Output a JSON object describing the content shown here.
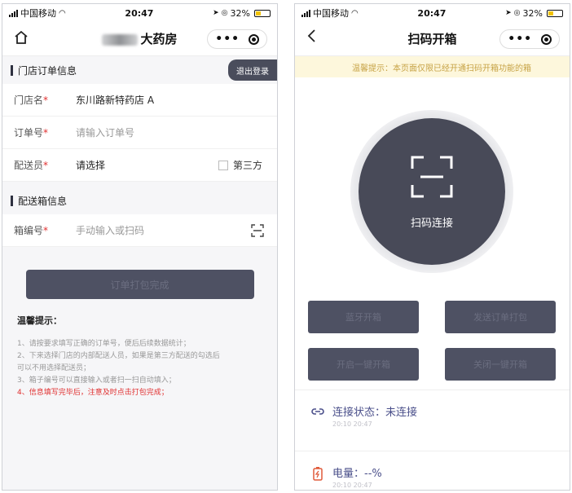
{
  "left": {
    "status": {
      "carrier": "中国移动",
      "time": "20:47",
      "battery": "32%"
    },
    "nav": {
      "title_suffix": "大药房"
    },
    "section_order": {
      "title": "门店订单信息",
      "logout": "退出登录"
    },
    "fields": {
      "store": {
        "label": "门店名",
        "value": "东川路新特药店 A"
      },
      "order": {
        "label": "订单号",
        "placeholder": "请输入订单号"
      },
      "courier": {
        "label": "配送员",
        "value": "请选择",
        "third_party": "第三方"
      }
    },
    "section_box": {
      "title": "配送箱信息"
    },
    "box_field": {
      "label": "箱编号",
      "placeholder": "手动输入或扫码"
    },
    "submit_label": "订单打包完成",
    "tips": {
      "title": "温馨提示：",
      "lines": [
        "1、请按要求填写正确的订单号，便后后续数据统计；",
        "2、下来选择门店的内部配送人员，如果是第三方配送的勾选后",
        "可以不用选择配送员；",
        "3、箱子编号可以直接输入或者扫一扫自动填入；"
      ],
      "warning": "4、信息填写完毕后，注意及时点击打包完成；"
    }
  },
  "right": {
    "status": {
      "carrier": "中国移动",
      "time": "20:47",
      "battery": "32%"
    },
    "nav": {
      "title": "扫码开箱"
    },
    "notice": "温馨提示：本页面仅限已经开通扫码开箱功能的箱",
    "scan_label": "扫码连接",
    "buttons": [
      "蓝牙开箱",
      "发送订单打包",
      "开启一键开箱",
      "关闭一键开箱"
    ],
    "connection": {
      "label": "连接状态：未连接",
      "time": "20:10 20:47"
    },
    "power": {
      "label": "电量：--%",
      "time": "20:10 20:47"
    }
  }
}
